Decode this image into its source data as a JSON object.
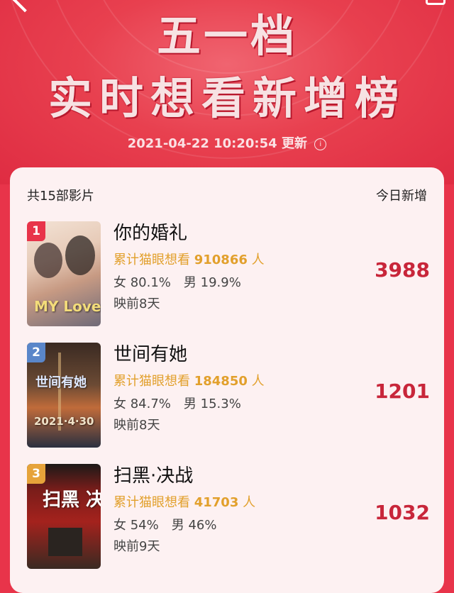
{
  "header": {
    "title_line1": "五一档",
    "title_line2": "实时想看新增榜",
    "update_time": "2021-04-22 10:20:54",
    "update_label": "更新",
    "info_icon": "info-icon"
  },
  "list": {
    "total_label": "共15部影片",
    "today_label": "今日新增",
    "movies": [
      {
        "rank": "1",
        "rank_color": "#e8344a",
        "title": "你的婚礼",
        "want_label": "累计猫眼想看",
        "want_count": "910866",
        "want_unit": "人",
        "female": "女 80.1%",
        "male": "男 19.9%",
        "days": "映前8天",
        "today": "3988",
        "poster_text": "MY Love"
      },
      {
        "rank": "2",
        "rank_color": "#5a86c9",
        "title": "世间有她",
        "want_label": "累计猫眼想看",
        "want_count": "184850",
        "want_unit": "人",
        "female": "女 84.7%",
        "male": "男 15.3%",
        "days": "映前8天",
        "today": "1201",
        "poster_text": "2021·4·30"
      },
      {
        "rank": "3",
        "rank_color": "#e6a33a",
        "title": "扫黑·决战",
        "want_label": "累计猫眼想看",
        "want_count": "41703",
        "want_unit": "人",
        "female": "女 54%",
        "male": "男 46%",
        "days": "映前9天",
        "today": "1032",
        "poster_text": "扫黑 决战"
      }
    ]
  }
}
